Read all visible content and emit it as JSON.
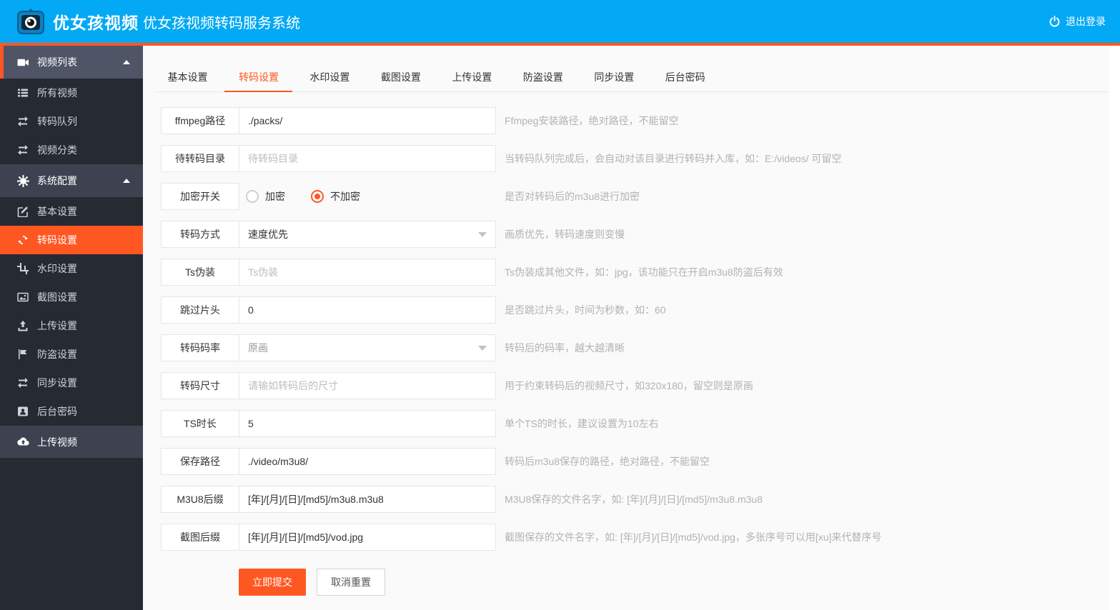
{
  "colors": {
    "accent": "#FF5722",
    "header_blue": "#03A9F4",
    "sidebar_dark": "#262A31"
  },
  "header": {
    "logo_text": "优女孩视频",
    "title": "优女孩视频转码服务系统",
    "logout_label": "退出登录"
  },
  "sidebar": {
    "items": [
      {
        "label": "视频列表",
        "icon": "videocam-icon",
        "group": true,
        "expanded": true
      },
      {
        "label": "所有视频",
        "icon": "list-icon"
      },
      {
        "label": "转码队列",
        "icon": "exchange-icon"
      },
      {
        "label": "视频分类",
        "icon": "exchange-icon"
      },
      {
        "label": "系统配置",
        "icon": "gear-icon",
        "group": true,
        "expanded": true
      },
      {
        "label": "基本设置",
        "icon": "edit-icon"
      },
      {
        "label": "转码设置",
        "icon": "loop-icon",
        "active": true
      },
      {
        "label": "水印设置",
        "icon": "crop-icon"
      },
      {
        "label": "截图设置",
        "icon": "image-icon"
      },
      {
        "label": "上传设置",
        "icon": "upload-icon"
      },
      {
        "label": "防盗设置",
        "icon": "flag-icon"
      },
      {
        "label": "同步设置",
        "icon": "exchange-icon"
      },
      {
        "label": "后台密码",
        "icon": "id-card-icon"
      },
      {
        "label": "上传视频",
        "icon": "cloud-upload-icon",
        "group": true
      }
    ]
  },
  "tabs": {
    "items": [
      "基本设置",
      "转码设置",
      "水印设置",
      "截图设置",
      "上传设置",
      "防盗设置",
      "同步设置",
      "后台密码"
    ],
    "active": "转码设置"
  },
  "form": {
    "rows": [
      {
        "label": "ffmpeg路径",
        "type": "input",
        "value": "./packs/",
        "hint": "Ffmpeg安装路径，绝对路径，不能留空"
      },
      {
        "label": "待转码目录",
        "type": "input",
        "placeholder": "待转码目录",
        "hint": "当转码队列完成后，会自动对该目录进行转码并入库，如：E:/videos/ 可留空"
      },
      {
        "label": "加密开关",
        "type": "radio",
        "options": [
          "加密",
          "不加密"
        ],
        "selected": "不加密",
        "hint": "是否对转码后的m3u8进行加密"
      },
      {
        "label": "转码方式",
        "type": "select",
        "value": "速度优先",
        "hint": "画质优先，转码速度则变慢"
      },
      {
        "label": "Ts伪装",
        "type": "input",
        "placeholder": "Ts伪装",
        "hint": "Ts伪装成其他文件，如：jpg，该功能只在开启m3u8防盗后有效"
      },
      {
        "label": "跳过片头",
        "type": "input",
        "value": "0",
        "hint": "是否跳过片头，时间为秒数，如：60"
      },
      {
        "label": "转码码率",
        "type": "select",
        "value": "原画",
        "hint": "转码后的码率，越大越清晰"
      },
      {
        "label": "转码尺寸",
        "type": "input",
        "placeholder": "请输如转码后的尺寸",
        "hint": "用于约束转码后的视频尺寸，如320x180，留空则是原画"
      },
      {
        "label": "TS时长",
        "type": "input",
        "value": "5",
        "hint": "单个TS的时长，建议设置为10左右"
      },
      {
        "label": "保存路径",
        "type": "input",
        "value": "./video/m3u8/",
        "hint": "转码后m3u8保存的路径，绝对路径，不能留空"
      },
      {
        "label": "M3U8后缀",
        "type": "input",
        "value": "[年]/[月]/[日]/[md5]/m3u8.m3u8",
        "hint": "M3U8保存的文件名字，如: [年]/[月]/[日]/[md5]/m3u8.m3u8"
      },
      {
        "label": "截图后缀",
        "type": "input",
        "value": "[年]/[月]/[日]/[md5]/vod.jpg",
        "hint": "截图保存的文件名字，如: [年]/[月]/[日]/[md5]/vod.jpg，多张序号可以用[xu]来代替序号"
      }
    ],
    "buttons": {
      "submit": "立即提交",
      "reset": "取消重置"
    }
  }
}
